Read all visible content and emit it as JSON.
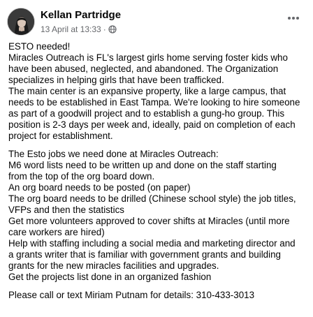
{
  "post": {
    "author": "Kellan Partridge",
    "date": "13 April at 13:33",
    "separator": "·",
    "audience_icon": "globe-icon",
    "more_icon": "more-options-icon",
    "paragraph1": [
      "ESTO needed!",
      "Miracles Outreach is FL's largest girls home serving foster kids who",
      "have been abused, neglected, and abandoned.  The Organization",
      "specializes in helping girls that have been trafficked.",
      "The main center is an expansive property, like a large campus, that",
      "needs to be established in East Tampa. We're looking to hire someone",
      "as part of a goodwill project and to establish a gung-ho group. This",
      "position is 2-3 days per week and, ideally, paid on completion of each",
      "project for establishment."
    ],
    "paragraph2": [
      "The Esto jobs we need done at Miracles Outreach:",
      "M6 word lists need to be written up and done on the staff starting",
      "from the top of the org board down.",
      "An org board needs to be posted (on paper)",
      "The org board needs to be drilled (Chinese school style) the job titles,",
      "VFPs and then the statistics",
      "Get more volunteers approved to cover shifts at Miracles (until more",
      "care workers are hired)",
      "Help with staffing including a social media and marketing director and",
      "a grants writer that is familiar with government grants and building",
      "grants for the new miracles facilities and upgrades.",
      "Get the projects list done in an organized fashion"
    ],
    "paragraph3": [
      "Please call or text Miriam Putnam for details: 310-433-3013"
    ]
  }
}
